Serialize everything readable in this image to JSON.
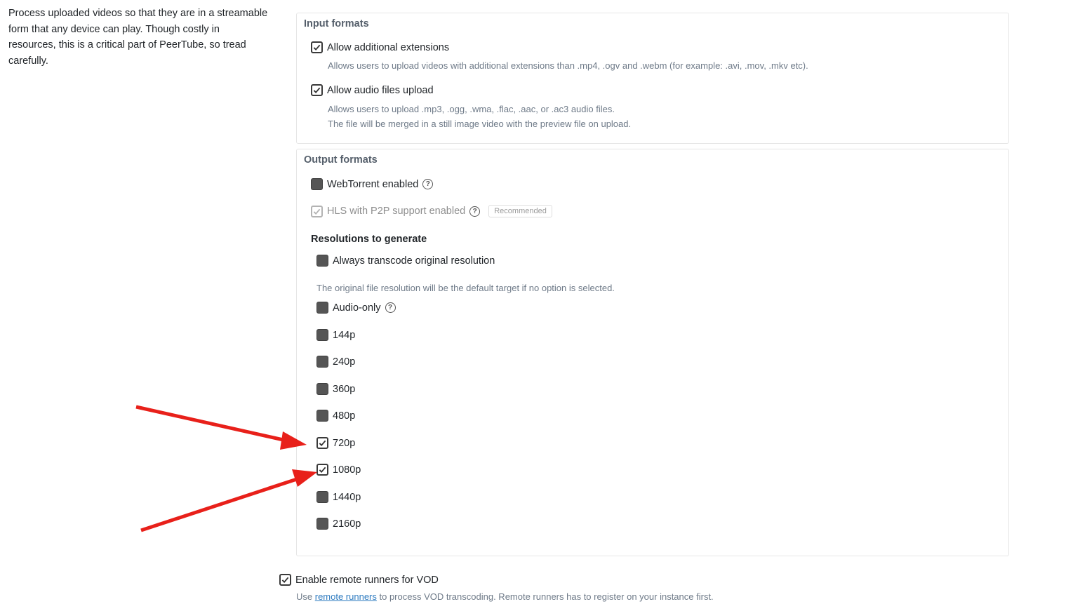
{
  "description": "Process uploaded videos so that they are in a streamable form that any device can play. Though costly in resources, this is a critical part of PeerTube, so tread carefully.",
  "input_formats": {
    "legend": "Input formats",
    "additional_extensions": {
      "label": "Allow additional extensions",
      "checked": true,
      "help": "Allows users to upload videos with additional extensions than .mp4, .ogv and .webm (for example: .avi, .mov, .mkv etc)."
    },
    "audio_files": {
      "label": "Allow audio files upload",
      "checked": true,
      "help_line1": "Allows users to upload .mp3, .ogg, .wma, .flac, .aac, or .ac3 audio files.",
      "help_line2": "The file will be merged in a still image video with the preview file on upload."
    }
  },
  "output_formats": {
    "legend": "Output formats",
    "webtorrent": {
      "label": "WebTorrent enabled",
      "checked": false,
      "icon": "help-icon"
    },
    "hls": {
      "label": "HLS with P2P support enabled",
      "checked": true,
      "disabled": true,
      "icon": "help-icon",
      "badge": "Recommended"
    },
    "resolutions_heading": "Resolutions to generate",
    "always_transcode": {
      "label": "Always transcode original resolution",
      "checked": false
    },
    "default_target_note": "The original file resolution will be the default target if no option is selected.",
    "audio_only": {
      "label": "Audio-only",
      "checked": false,
      "icon": "help-icon"
    },
    "resolutions": [
      {
        "label": "144p",
        "checked": false
      },
      {
        "label": "240p",
        "checked": false
      },
      {
        "label": "360p",
        "checked": false
      },
      {
        "label": "480p",
        "checked": false
      },
      {
        "label": "720p",
        "checked": true
      },
      {
        "label": "1080p",
        "checked": true
      },
      {
        "label": "1440p",
        "checked": false
      },
      {
        "label": "2160p",
        "checked": false
      }
    ]
  },
  "remote_runners": {
    "label": "Enable remote runners for VOD",
    "checked": true,
    "help_prefix": "Use ",
    "help_link": "remote runners",
    "help_suffix": " to process VOD transcoding. Remote runners has to register on your instance first."
  },
  "colors": {
    "arrow": "#e8201a",
    "checkbox_fill": "#555555",
    "help_text": "#6e7a88"
  }
}
